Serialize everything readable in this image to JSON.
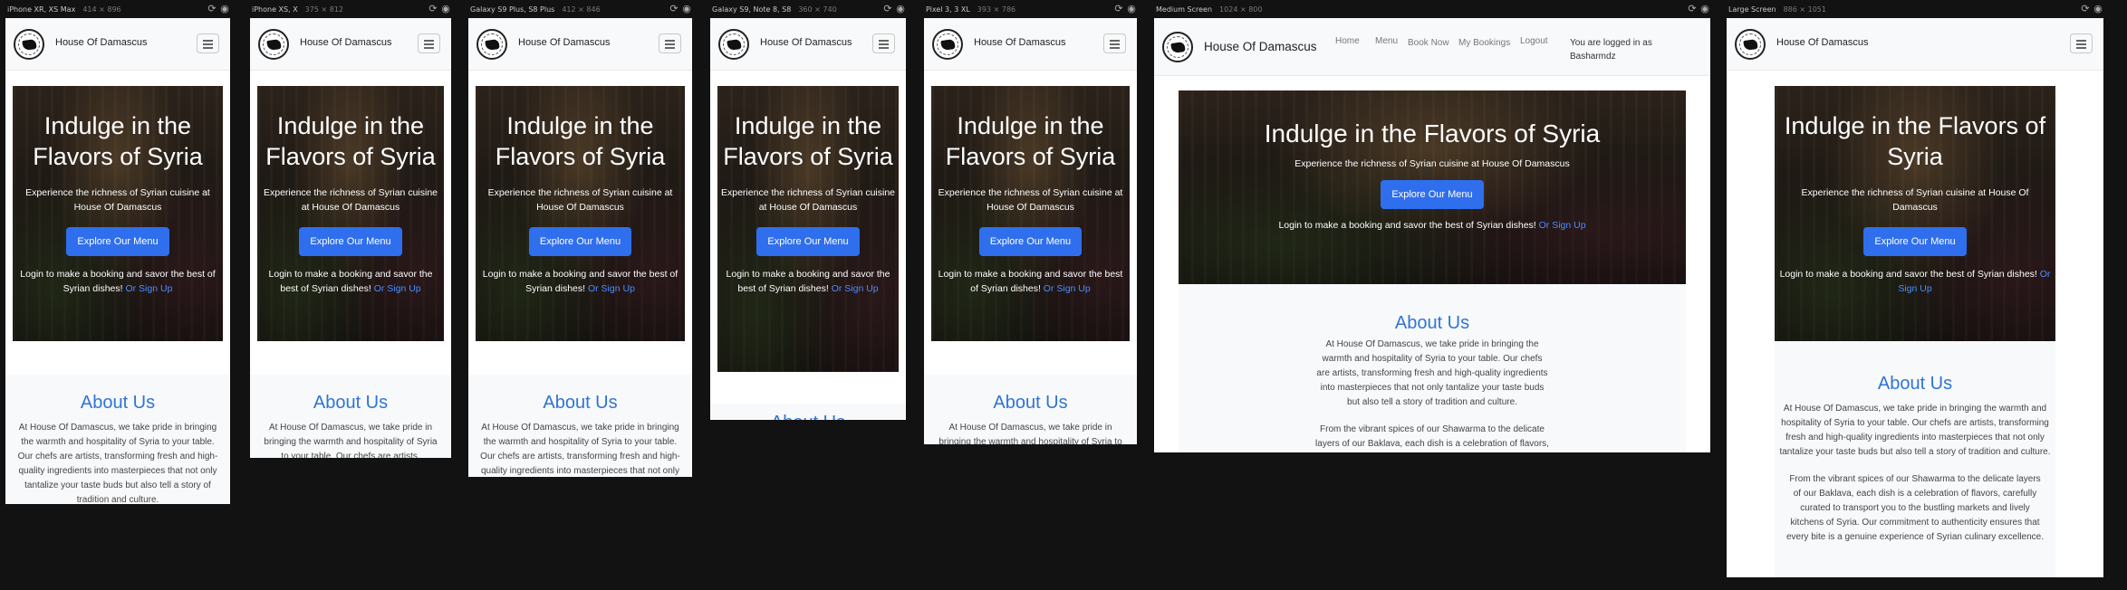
{
  "devices": [
    {
      "id": "iphone-xr",
      "name": "iPhone XR, XS Max",
      "size": "414 × 896"
    },
    {
      "id": "iphone-xs",
      "name": "iPhone XS, X",
      "size": "375 × 812"
    },
    {
      "id": "galaxy-s9plus",
      "name": "Galaxy S9 Plus, S8 Plus",
      "size": "412 × 846"
    },
    {
      "id": "galaxy-s9",
      "name": "Galaxy S9, Note 8, S8",
      "size": "360 × 740"
    },
    {
      "id": "pixel3",
      "name": "Pixel 3, 3 XL",
      "size": "393 × 786"
    },
    {
      "id": "medium",
      "name": "Medium Screen",
      "size": "1024 × 800"
    },
    {
      "id": "large",
      "name": "Large Screen",
      "size": "886 × 1051"
    }
  ],
  "site": {
    "brand": "House Of Damascus",
    "nav": {
      "home": "Home",
      "menu": "Menu",
      "book_now": "Book Now",
      "my_bookings": "My Bookings",
      "logout": "Logout",
      "status": "You are logged in as Basharmdz"
    },
    "hero": {
      "title": "Indulge in the Flavors of Syria",
      "subtitle": "Experience the richness of Syrian cuisine at House Of Damascus",
      "cta": "Explore Our Menu",
      "login_text": "Login to make a booking and savor the best of Syrian dishes!",
      "signup_link": "Or Sign Up"
    },
    "about": {
      "heading": "About Us",
      "p1": "At House Of Damascus, we take pride in bringing the warmth and hospitality of Syria to your table. Our chefs are artists, transforming fresh and high-quality ingredients into masterpieces that not only tantalize your taste buds but also tell a story of tradition and culture.",
      "p2": "From the vibrant spices of our Shawarma to the delicate layers of our Baklava, each dish is a celebration of flavors, carefully curated to transport you to the bustling markets and lively kitchens of Syria. Our commitment to authenticity ensures that every bite is a genuine experience of Syrian culinary excellence."
    }
  },
  "colors": {
    "accent": "#2f6fed",
    "heading": "#2f74d8",
    "link": "#4a8dff",
    "canvas": "#121212"
  },
  "icons": [
    "rotate-icon",
    "camera-icon",
    "hamburger-icon",
    "logo-icon"
  ]
}
